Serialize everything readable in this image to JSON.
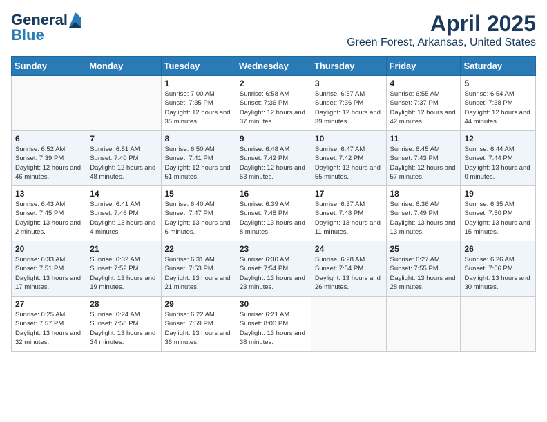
{
  "header": {
    "logo_general": "General",
    "logo_blue": "Blue",
    "title": "April 2025",
    "subtitle": "Green Forest, Arkansas, United States"
  },
  "calendar": {
    "days_of_week": [
      "Sunday",
      "Monday",
      "Tuesday",
      "Wednesday",
      "Thursday",
      "Friday",
      "Saturday"
    ],
    "weeks": [
      [
        {
          "day": "",
          "info": ""
        },
        {
          "day": "",
          "info": ""
        },
        {
          "day": "1",
          "info": "Sunrise: 7:00 AM\nSunset: 7:35 PM\nDaylight: 12 hours and 35 minutes."
        },
        {
          "day": "2",
          "info": "Sunrise: 6:58 AM\nSunset: 7:36 PM\nDaylight: 12 hours and 37 minutes."
        },
        {
          "day": "3",
          "info": "Sunrise: 6:57 AM\nSunset: 7:36 PM\nDaylight: 12 hours and 39 minutes."
        },
        {
          "day": "4",
          "info": "Sunrise: 6:55 AM\nSunset: 7:37 PM\nDaylight: 12 hours and 42 minutes."
        },
        {
          "day": "5",
          "info": "Sunrise: 6:54 AM\nSunset: 7:38 PM\nDaylight: 12 hours and 44 minutes."
        }
      ],
      [
        {
          "day": "6",
          "info": "Sunrise: 6:52 AM\nSunset: 7:39 PM\nDaylight: 12 hours and 46 minutes."
        },
        {
          "day": "7",
          "info": "Sunrise: 6:51 AM\nSunset: 7:40 PM\nDaylight: 12 hours and 48 minutes."
        },
        {
          "day": "8",
          "info": "Sunrise: 6:50 AM\nSunset: 7:41 PM\nDaylight: 12 hours and 51 minutes."
        },
        {
          "day": "9",
          "info": "Sunrise: 6:48 AM\nSunset: 7:42 PM\nDaylight: 12 hours and 53 minutes."
        },
        {
          "day": "10",
          "info": "Sunrise: 6:47 AM\nSunset: 7:42 PM\nDaylight: 12 hours and 55 minutes."
        },
        {
          "day": "11",
          "info": "Sunrise: 6:45 AM\nSunset: 7:43 PM\nDaylight: 12 hours and 57 minutes."
        },
        {
          "day": "12",
          "info": "Sunrise: 6:44 AM\nSunset: 7:44 PM\nDaylight: 13 hours and 0 minutes."
        }
      ],
      [
        {
          "day": "13",
          "info": "Sunrise: 6:43 AM\nSunset: 7:45 PM\nDaylight: 13 hours and 2 minutes."
        },
        {
          "day": "14",
          "info": "Sunrise: 6:41 AM\nSunset: 7:46 PM\nDaylight: 13 hours and 4 minutes."
        },
        {
          "day": "15",
          "info": "Sunrise: 6:40 AM\nSunset: 7:47 PM\nDaylight: 13 hours and 6 minutes."
        },
        {
          "day": "16",
          "info": "Sunrise: 6:39 AM\nSunset: 7:48 PM\nDaylight: 13 hours and 8 minutes."
        },
        {
          "day": "17",
          "info": "Sunrise: 6:37 AM\nSunset: 7:48 PM\nDaylight: 13 hours and 11 minutes."
        },
        {
          "day": "18",
          "info": "Sunrise: 6:36 AM\nSunset: 7:49 PM\nDaylight: 13 hours and 13 minutes."
        },
        {
          "day": "19",
          "info": "Sunrise: 6:35 AM\nSunset: 7:50 PM\nDaylight: 13 hours and 15 minutes."
        }
      ],
      [
        {
          "day": "20",
          "info": "Sunrise: 6:33 AM\nSunset: 7:51 PM\nDaylight: 13 hours and 17 minutes."
        },
        {
          "day": "21",
          "info": "Sunrise: 6:32 AM\nSunset: 7:52 PM\nDaylight: 13 hours and 19 minutes."
        },
        {
          "day": "22",
          "info": "Sunrise: 6:31 AM\nSunset: 7:53 PM\nDaylight: 13 hours and 21 minutes."
        },
        {
          "day": "23",
          "info": "Sunrise: 6:30 AM\nSunset: 7:54 PM\nDaylight: 13 hours and 23 minutes."
        },
        {
          "day": "24",
          "info": "Sunrise: 6:28 AM\nSunset: 7:54 PM\nDaylight: 13 hours and 26 minutes."
        },
        {
          "day": "25",
          "info": "Sunrise: 6:27 AM\nSunset: 7:55 PM\nDaylight: 13 hours and 28 minutes."
        },
        {
          "day": "26",
          "info": "Sunrise: 6:26 AM\nSunset: 7:56 PM\nDaylight: 13 hours and 30 minutes."
        }
      ],
      [
        {
          "day": "27",
          "info": "Sunrise: 6:25 AM\nSunset: 7:57 PM\nDaylight: 13 hours and 32 minutes."
        },
        {
          "day": "28",
          "info": "Sunrise: 6:24 AM\nSunset: 7:58 PM\nDaylight: 13 hours and 34 minutes."
        },
        {
          "day": "29",
          "info": "Sunrise: 6:22 AM\nSunset: 7:59 PM\nDaylight: 13 hours and 36 minutes."
        },
        {
          "day": "30",
          "info": "Sunrise: 6:21 AM\nSunset: 8:00 PM\nDaylight: 13 hours and 38 minutes."
        },
        {
          "day": "",
          "info": ""
        },
        {
          "day": "",
          "info": ""
        },
        {
          "day": "",
          "info": ""
        }
      ]
    ]
  }
}
